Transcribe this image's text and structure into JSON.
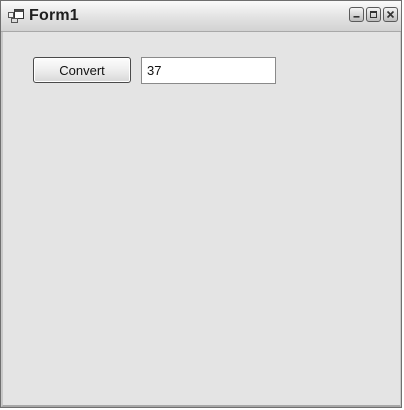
{
  "window": {
    "title": "Form1",
    "icons": {
      "app": "form-window-icon",
      "minimize": "minimize-icon",
      "maximize": "maximize-icon",
      "close": "close-icon"
    }
  },
  "form": {
    "convert_button_label": "Convert",
    "input_value": "37"
  }
}
